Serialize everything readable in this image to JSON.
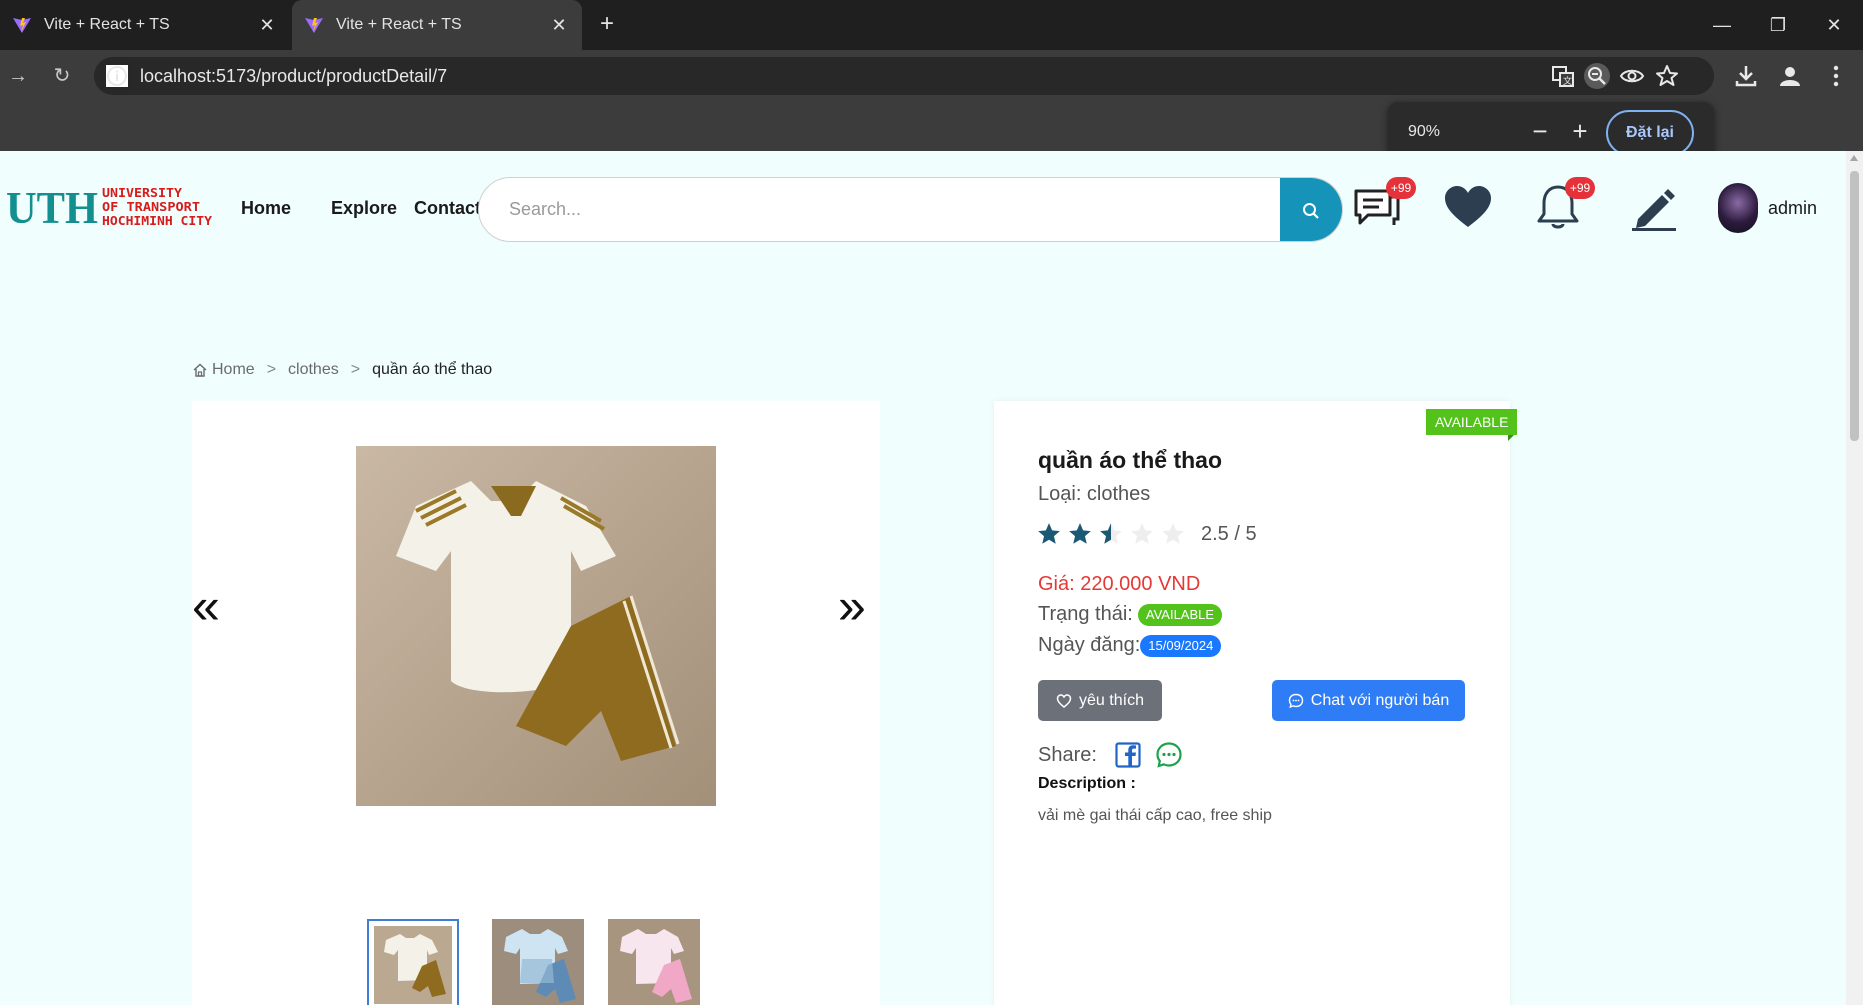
{
  "browser": {
    "tabs": [
      {
        "title": "Vite + React + TS",
        "active": false
      },
      {
        "title": "Vite + React + TS",
        "active": true
      }
    ],
    "url": "localhost:5173/product/productDetail/7",
    "zoom": {
      "level": "90%",
      "reset_label": "Đặt lại"
    }
  },
  "header": {
    "logo": {
      "big": "UTH",
      "line1": "UNIVERSITY",
      "line2": "OF TRANSPORT",
      "line3": "HOCHIMINH CITY"
    },
    "nav": [
      "Home",
      "Explore",
      "Contact"
    ],
    "search_placeholder": "Search...",
    "messages_badge": "+99",
    "notifications_badge": "+99",
    "username": "admin"
  },
  "breadcrumb": {
    "home": "Home",
    "sep": ">",
    "category": "clothes",
    "current": "quần áo thể thao"
  },
  "product": {
    "ribbon": "AVAILABLE",
    "title": "quần áo thể thao",
    "type": "Loại: clothes",
    "rating": 2.5,
    "rating_text": "2.5 / 5",
    "price": "Giá: 220.000 VND",
    "status_label": "Trạng thái:",
    "status": "AVAILABLE",
    "date_label": "Ngày đăng:",
    "date": "15/09/2024",
    "like_label": "yêu thích",
    "chat_label": "Chat với người bán",
    "share_label": "Share:",
    "description_label": "Description :",
    "description": "vải mè gai thái cấp cao, free ship"
  },
  "gallery": {
    "prev": "«",
    "next": "»",
    "selected_index": 0
  },
  "colors": {
    "accent": "#1593b8",
    "price": "#e53935",
    "available": "#53c31b",
    "date": "#1a78ff",
    "chat": "#2f7df6"
  }
}
